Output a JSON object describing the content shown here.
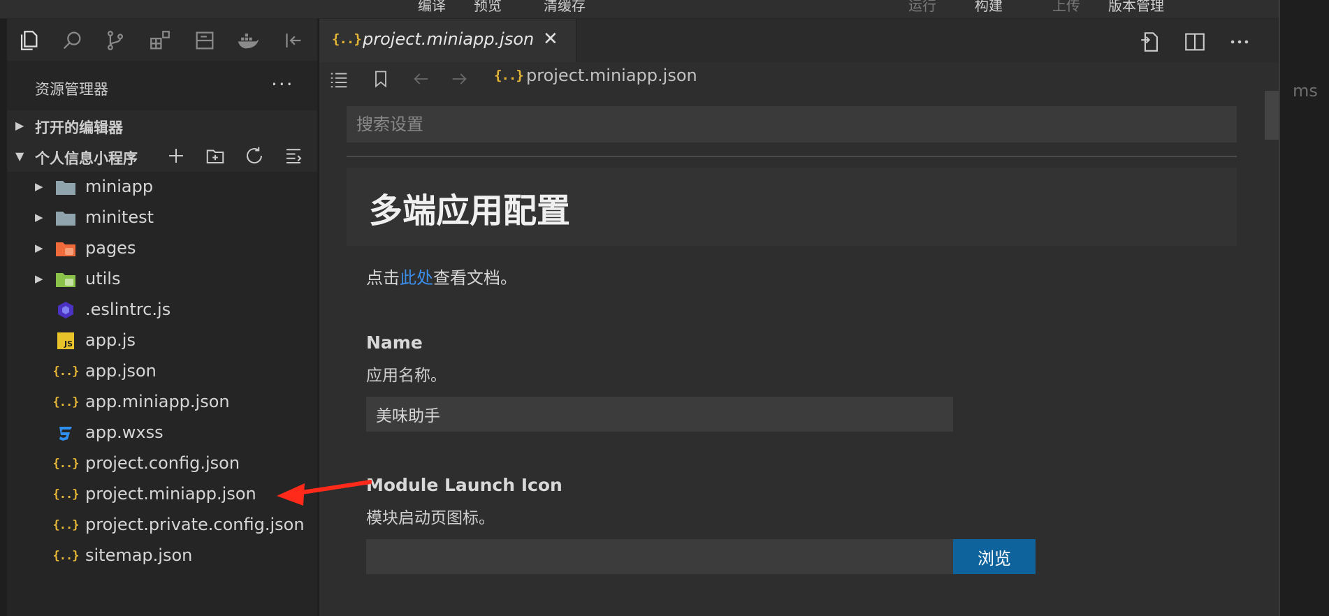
{
  "topbar": {
    "items": [
      "编译",
      "预览",
      "清缓存",
      "运行",
      "构建",
      "上传",
      "版本管理"
    ]
  },
  "explorer": {
    "title": "资源管理器",
    "more": "···",
    "open_editors": "打开的编辑器",
    "project": "个人信息小程序",
    "files": [
      {
        "name": "miniapp",
        "type": "folder"
      },
      {
        "name": "minitest",
        "type": "folder"
      },
      {
        "name": "pages",
        "type": "folder-pages"
      },
      {
        "name": "utils",
        "type": "folder-utils"
      },
      {
        "name": ".eslintrc.js",
        "type": "eslint"
      },
      {
        "name": "app.js",
        "type": "js"
      },
      {
        "name": "app.json",
        "type": "json"
      },
      {
        "name": "app.miniapp.json",
        "type": "json"
      },
      {
        "name": "app.wxss",
        "type": "css"
      },
      {
        "name": "project.config.json",
        "type": "json"
      },
      {
        "name": "project.miniapp.json",
        "type": "json"
      },
      {
        "name": "project.private.config.json",
        "type": "json"
      },
      {
        "name": "sitemap.json",
        "type": "json"
      }
    ]
  },
  "editor": {
    "tab_title": "project.miniapp.json",
    "tab_close": "✕",
    "json_icon": "{..}",
    "breadcrumb": "project.miniapp.json",
    "search_placeholder": "搜索设置",
    "heading": "多端应用配置",
    "doc_prefix": "点击",
    "doc_link": "此处",
    "doc_suffix": "查看文档。",
    "name_label": "Name",
    "name_desc": "应用名称。",
    "name_value": "美味助手",
    "icon_label": "Module Launch Icon",
    "icon_desc": "模块启动页图标。",
    "icon_value": "",
    "browse_label": "浏览"
  },
  "right": {
    "text": "ms"
  },
  "colors": {
    "accent_link": "#3b8eea",
    "button": "#0e639c",
    "json_icon": "#e5b636",
    "annotation_arrow": "#ff2a1a"
  }
}
